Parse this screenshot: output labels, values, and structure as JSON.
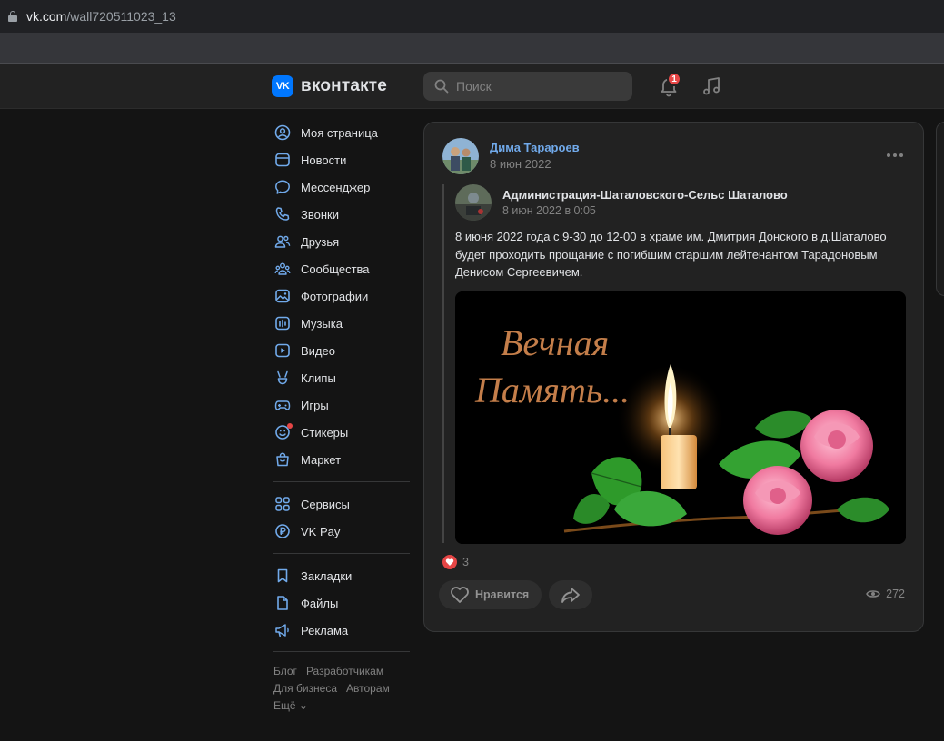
{
  "browser": {
    "url_host": "vk.com",
    "url_path": "/wall720511023_13"
  },
  "header": {
    "logo_badge": "VK",
    "logo_text": "вконтакте",
    "search_placeholder": "Поиск",
    "notifications_count": "1",
    "icons": [
      "search-icon",
      "bell-icon",
      "music-icon"
    ]
  },
  "sidebar": {
    "items": [
      {
        "label": "Моя страница",
        "icon": "user-icon"
      },
      {
        "label": "Новости",
        "icon": "news-icon"
      },
      {
        "label": "Мессенджер",
        "icon": "messenger-icon"
      },
      {
        "label": "Звонки",
        "icon": "phone-icon"
      },
      {
        "label": "Друзья",
        "icon": "friends-icon"
      },
      {
        "label": "Сообщества",
        "icon": "communities-icon"
      },
      {
        "label": "Фотографии",
        "icon": "photos-icon"
      },
      {
        "label": "Музыка",
        "icon": "music-icon"
      },
      {
        "label": "Видео",
        "icon": "video-icon"
      },
      {
        "label": "Клипы",
        "icon": "clips-icon"
      },
      {
        "label": "Игры",
        "icon": "games-icon"
      },
      {
        "label": "Стикеры",
        "icon": "stickers-icon"
      },
      {
        "label": "Маркет",
        "icon": "market-icon"
      }
    ],
    "group2": [
      {
        "label": "Сервисы",
        "icon": "services-icon"
      },
      {
        "label": "VK Pay",
        "icon": "vkpay-icon"
      }
    ],
    "group3": [
      {
        "label": "Закладки",
        "icon": "bookmarks-icon"
      },
      {
        "label": "Файлы",
        "icon": "files-icon"
      },
      {
        "label": "Реклама",
        "icon": "ads-icon"
      }
    ],
    "footer": {
      "blog": "Блог",
      "developers": "Разработчикам",
      "business": "Для бизнеса",
      "authors": "Авторам",
      "more": "Ещё ⌄"
    }
  },
  "post": {
    "author": "Дима Тарароев",
    "date": "8 июн 2022",
    "repost": {
      "author": "Администрация-Шаталовского-Сельс Шаталово",
      "date": "8 июн 2022 в 0:05",
      "text": "8 июня 2022 года с 9-30 до 12-00 в храме им. Дмитрия Донского в д.Шаталово будет проходить прощание с погибшим старшим лейтенантом Тарадоновым Денисом Сергеевичем.",
      "image_caption_line1": "Вечная",
      "image_caption_line2": "Память..."
    },
    "reactions_count": "3",
    "like_label": "Нравится",
    "views": "272"
  },
  "colors": {
    "accent": "#71aaeb",
    "brand": "#0077ff",
    "badge": "#e64646",
    "icon": "#71aaeb"
  }
}
